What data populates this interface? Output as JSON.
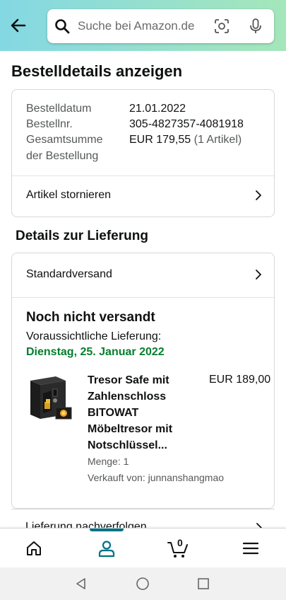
{
  "search": {
    "placeholder": "Suche bei Amazon.de"
  },
  "page": {
    "title": "Bestelldetails anzeigen"
  },
  "summary": {
    "order_date_label": "Bestelldatum",
    "order_date": "21.01.2022",
    "order_no_label": "Bestellnr.",
    "order_no": "305-4827357-4081918",
    "total_label_line1": "Gesamtsumme",
    "total_label_line2": "der Bestellung",
    "total_value": "EUR 179,55",
    "total_items": "(1 Artikel)",
    "cancel_label": "Artikel stornieren"
  },
  "delivery": {
    "section_title": "Details zur Lieferung",
    "shipping_method": "Standardversand",
    "status": "Noch nicht versandt",
    "estimated_label": "Voraussichtliche Lieferung:",
    "estimated_date": "Dienstag, 25. Januar 2022",
    "product": {
      "name_line1": "Tresor Safe mit",
      "name_line2": "Zahlenschloss",
      "name_line3": "BITOWAT",
      "name_line4": "Möbeltresor mit",
      "name_line5": "Notschlüssel...",
      "price": "EUR 189,00",
      "quantity": "Menge: 1",
      "seller": "Verkauft von: junnanshangmao"
    },
    "track_label": "Lieferung nachverfolgen"
  },
  "nav": {
    "cart_count": "0"
  },
  "colors": {
    "accent_teal": "#007185",
    "delivery_green": "#067d2e",
    "header_start": "#84d8e3",
    "header_end": "#a5e6ba"
  }
}
